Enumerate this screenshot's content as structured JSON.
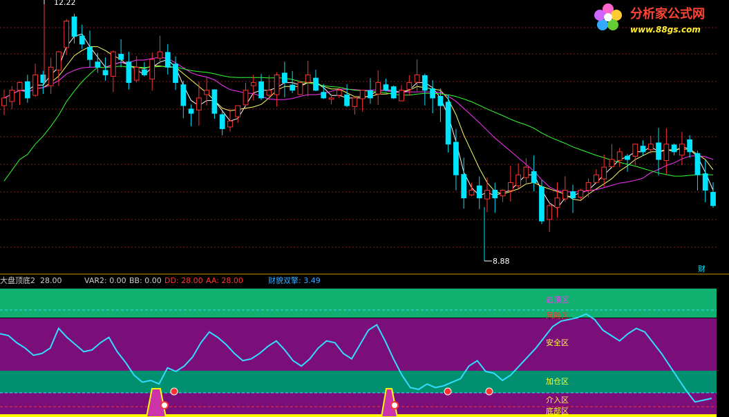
{
  "logo": {
    "name": "分析家公式网",
    "url": "www.88gs.com"
  },
  "price_chart": {
    "high_label": "12.22",
    "low_label": "8.88",
    "corner_label": "财"
  },
  "indicator_bar": {
    "name": "大盘顶底2",
    "name_value": "28.00",
    "var2": "VAR2: 0.00",
    "bb": "BB: 0.00",
    "dd": "DD: 28.00",
    "aa": "AA: 28.00",
    "extra": "财貌双擎: 3.49"
  },
  "zones": [
    {
      "label": "逃顶区",
      "color": "#ff33ff"
    },
    {
      "label": "风险区",
      "color": "#ff3333"
    },
    {
      "label": "安全区",
      "color": "#ffff33"
    },
    {
      "label": "加仓区",
      "color": "#ffff33"
    },
    {
      "label": "介入区",
      "color": "#ffff33"
    },
    {
      "label": "底部区",
      "color": "#ffff33"
    }
  ],
  "colors": {
    "up": "#ff3333",
    "down": "#00e5ff",
    "ma_short": "#ffffff",
    "ma_mid": "#ffff66",
    "ma_long": "#ff33ff",
    "ma_longest": "#33ff33",
    "osc": "#33ddff",
    "band_top": "#10b070",
    "band_purple": "#7a0f7a",
    "band_teal": "#009070"
  },
  "chart_data": [
    {
      "type": "candlestick",
      "ylim": [
        8.88,
        12.22
      ],
      "high": 12.22,
      "low": 8.88,
      "price_path": [
        11.0,
        11.1,
        11.2,
        11.0,
        11.3,
        11.2,
        11.4,
        11.6,
        12.0,
        11.8,
        11.7,
        11.5,
        11.4,
        11.3,
        11.6,
        11.5,
        11.2,
        11.4,
        11.3,
        11.5,
        11.6,
        11.4,
        11.2,
        10.9,
        10.8,
        11.0,
        11.1,
        10.8,
        10.6,
        10.7,
        10.9,
        11.1,
        11.2,
        11.0,
        11.1,
        11.3,
        11.2,
        11.1,
        11.2,
        11.3,
        11.1,
        11.0,
        11.0,
        11.1,
        10.9,
        11.0,
        11.1,
        11.0,
        11.2,
        11.1,
        11.0,
        11.1,
        11.2,
        11.3,
        11.1,
        11.0,
        10.9,
        10.4,
        10.0,
        9.7,
        9.8,
        9.7,
        9.8,
        9.7,
        9.8,
        9.9,
        10.0,
        10.1,
        9.9,
        9.4,
        9.6,
        9.7,
        9.8,
        9.7,
        9.8,
        9.9,
        10.0,
        10.1,
        10.2,
        10.3,
        10.2,
        10.4,
        10.3,
        10.4,
        10.2,
        10.4,
        10.3,
        10.4,
        10.3,
        10.0,
        9.8,
        9.6
      ]
    },
    {
      "type": "line",
      "name": "大盘顶底2",
      "ylim": [
        0,
        100
      ],
      "values": [
        82,
        80,
        72,
        66,
        58,
        60,
        66,
        88,
        78,
        70,
        62,
        64,
        72,
        78,
        62,
        50,
        36,
        28,
        30,
        26,
        44,
        40,
        46,
        56,
        72,
        84,
        78,
        70,
        60,
        52,
        54,
        60,
        68,
        74,
        64,
        52,
        46,
        54,
        66,
        74,
        72,
        60,
        54,
        70,
        86,
        92,
        74,
        54,
        36,
        22,
        20,
        26,
        22,
        24,
        28,
        32,
        46,
        52,
        40,
        38,
        30,
        36,
        46,
        56,
        66,
        78,
        90,
        96,
        98,
        100,
        104,
        98,
        86,
        80,
        74,
        82,
        88,
        84,
        72,
        60,
        46,
        32,
        18,
        6,
        8,
        10
      ]
    }
  ]
}
